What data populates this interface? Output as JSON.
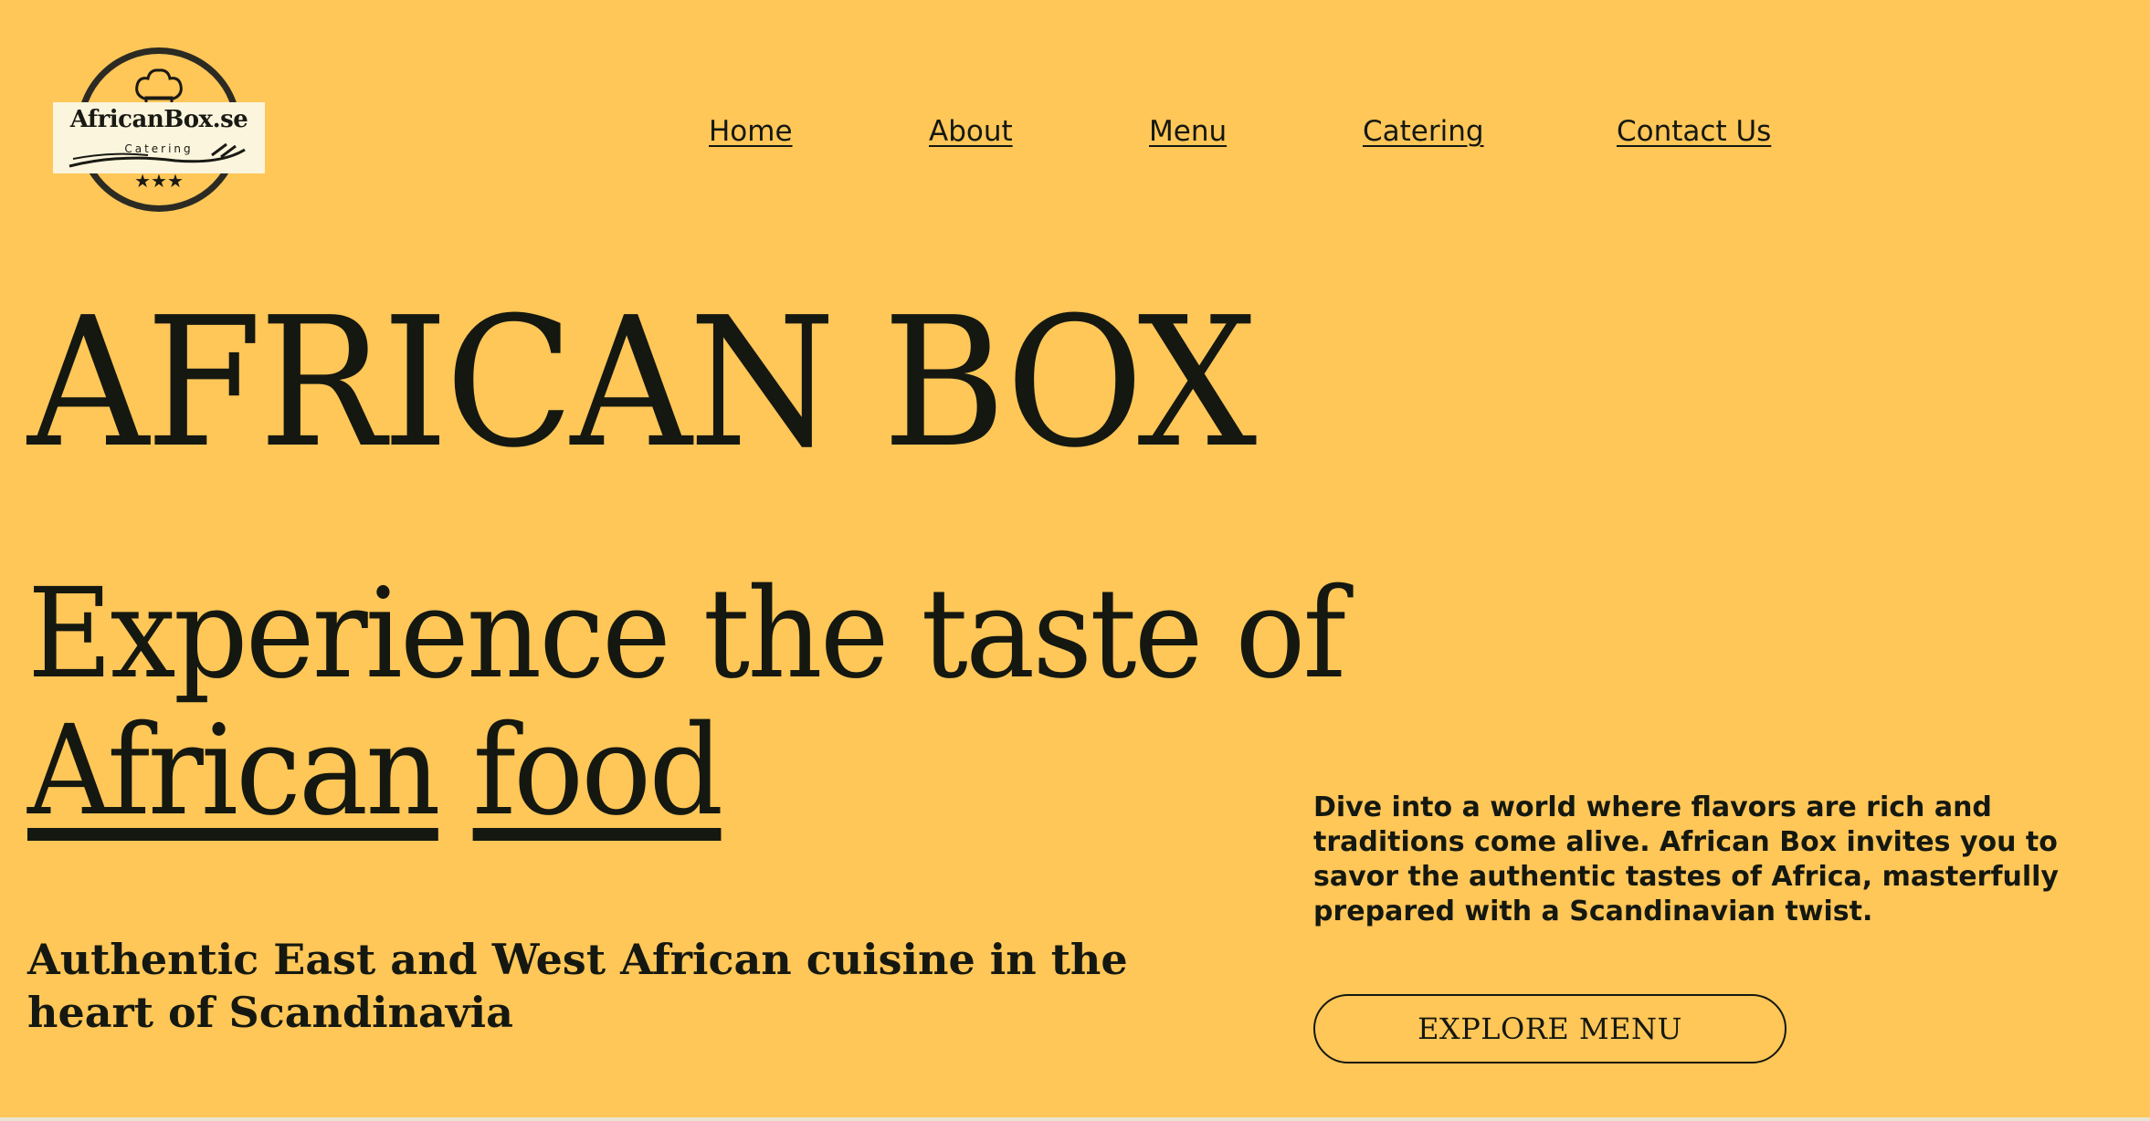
{
  "logo": {
    "title": "AfricanBox.se",
    "subtitle": "Catering",
    "stars": "★★★"
  },
  "nav": {
    "items": [
      {
        "label": "Home"
      },
      {
        "label": "About"
      },
      {
        "label": "Menu"
      },
      {
        "label": "Catering"
      },
      {
        "label": "Contact Us"
      }
    ]
  },
  "hero": {
    "title": "AFRICAN BOX",
    "tagline_line1": "Experience the taste of",
    "tagline_word1": "African",
    "tagline_word2": "food",
    "subtitle": "Authentic East and West African cuisine in the heart of Scandinavia",
    "description": "Dive into a world where flavors are rich and traditions come alive. African Box invites you to savor the authentic tastes of Africa, masterfully prepared with a Scandinavian twist.",
    "cta_label": "EXPLORE MENU"
  },
  "colors": {
    "background": "#FFC658",
    "text": "#141810"
  }
}
